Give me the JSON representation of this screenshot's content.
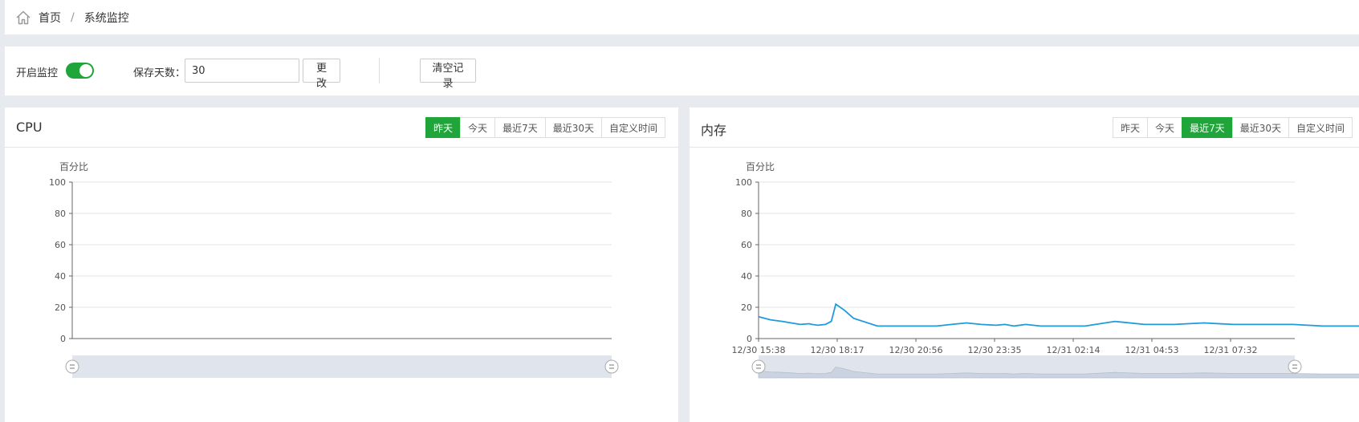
{
  "breadcrumb": {
    "home": "首页",
    "separator": "/",
    "current": "系统监控"
  },
  "controls": {
    "monitor_label": "开启监控",
    "monitor_enabled": true,
    "days_label": "保存天数：",
    "days_value": "30",
    "change_button": "更改",
    "clear_button": "清空记录"
  },
  "colors": {
    "accent": "#20a53a",
    "line": "#1d9ae0",
    "slider": "#dfe4ed"
  },
  "cpu_panel": {
    "title": "CPU",
    "ranges": [
      "昨天",
      "今天",
      "最近7天",
      "最近30天",
      "自定义时间"
    ],
    "active_range": 0
  },
  "mem_panel": {
    "title": "内存",
    "ranges": [
      "昨天",
      "今天",
      "最近7天",
      "最近30天",
      "自定义时间"
    ],
    "active_range": 2
  },
  "chart_data": [
    {
      "type": "line",
      "title": "",
      "ylabel": "百分比",
      "xlabel": "",
      "ylim": [
        0,
        100
      ],
      "yticks": [
        0,
        20,
        40,
        60,
        80,
        100
      ],
      "x": [],
      "series": [
        {
          "values": []
        }
      ],
      "grid": true,
      "zoom_slider": true
    },
    {
      "type": "line",
      "title": "",
      "ylabel": "百分比",
      "xlabel": "",
      "ylim": [
        0,
        100
      ],
      "yticks": [
        0,
        20,
        40,
        60,
        80,
        100
      ],
      "xticks": [
        "12/30 15:38",
        "12/30 18:17",
        "12/30 20:56",
        "12/30 23:35",
        "12/31 02:14",
        "12/31 04:53",
        "12/31 07:32"
      ],
      "x_hours": [
        0,
        0.4,
        0.8,
        1.1,
        1.4,
        1.7,
        1.8,
        2,
        2.25,
        2.45,
        2.6,
        2.9,
        3.2,
        4,
        5,
        6,
        6.5,
        7,
        7.5,
        8,
        8.3,
        8.6,
        9,
        9.5,
        10,
        11,
        12,
        13,
        14,
        15,
        16,
        17,
        18,
        19,
        20,
        21,
        22,
        23,
        24,
        25,
        26,
        27,
        28,
        29,
        30,
        31,
        32,
        32.5,
        33,
        34,
        35,
        36,
        37,
        38,
        38.5,
        39,
        39.3,
        40.5
      ],
      "series": [
        {
          "values": [
            14,
            12,
            11,
            10,
            9,
            9.5,
            9,
            8.5,
            9,
            11,
            22,
            18,
            13,
            8,
            8,
            8,
            9,
            10,
            9,
            8.5,
            9,
            8,
            9,
            8,
            8,
            8,
            11,
            9,
            9,
            10,
            9,
            9,
            9,
            8,
            8,
            8,
            9,
            8,
            8,
            8,
            8,
            8,
            8,
            8,
            8,
            8,
            9,
            8,
            8,
            9,
            8,
            6,
            6,
            6,
            6,
            6,
            7,
            6
          ]
        }
      ],
      "grid": true,
      "zoom_slider": true
    }
  ]
}
